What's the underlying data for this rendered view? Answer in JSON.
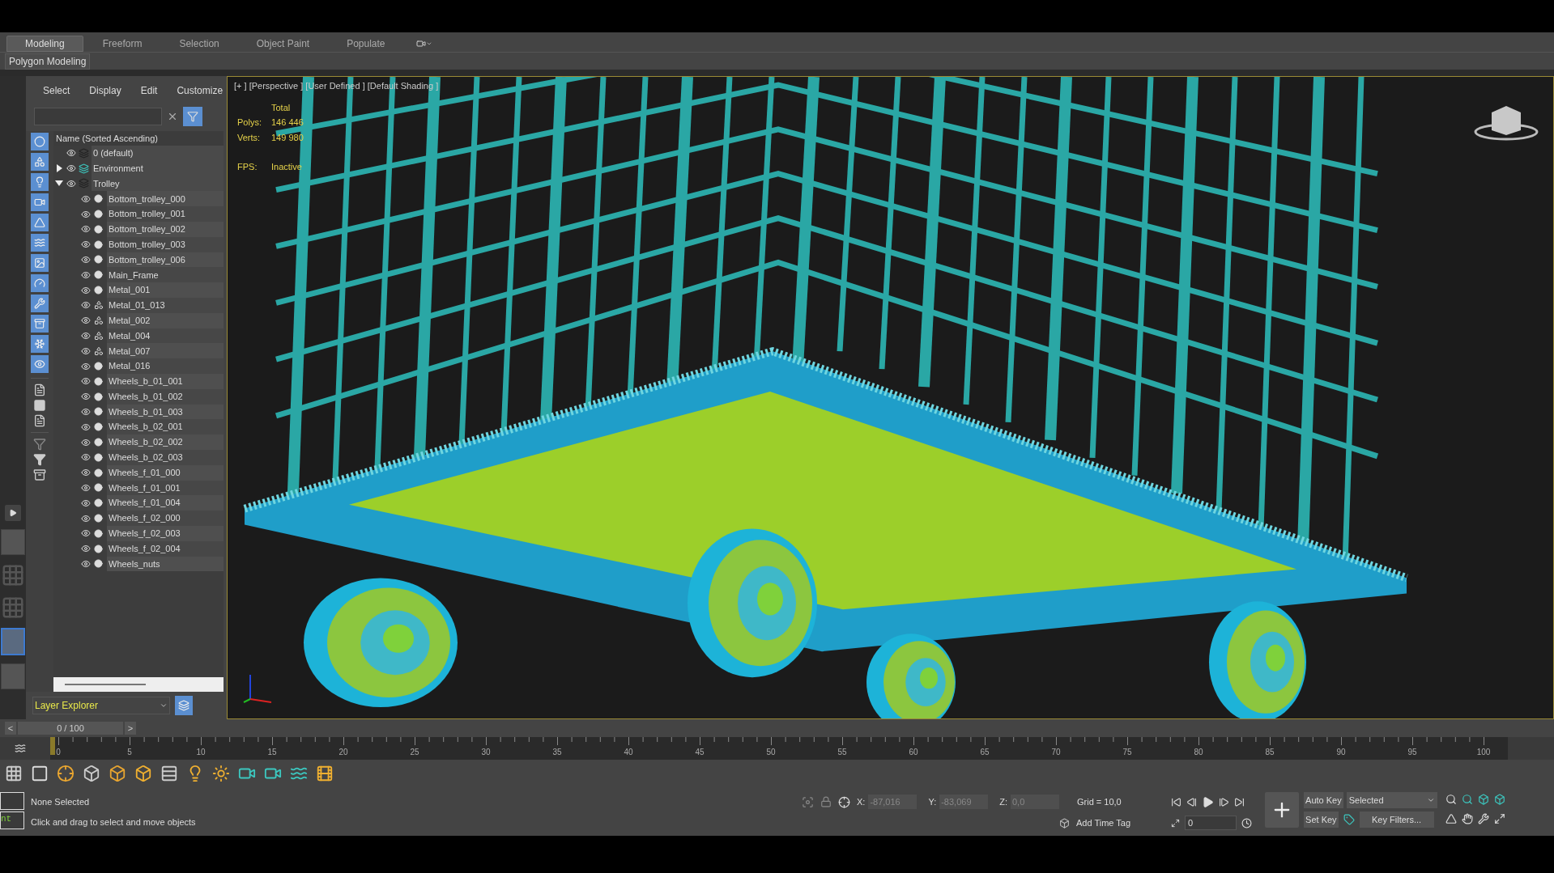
{
  "ribbon": {
    "tabs": [
      {
        "label": "Modeling",
        "selected": true
      },
      {
        "label": "Freeform",
        "selected": false
      },
      {
        "label": "Selection",
        "selected": false
      },
      {
        "label": "Object Paint",
        "selected": false
      },
      {
        "label": "Populate",
        "selected": false
      }
    ],
    "panel_label": "Polygon Modeling"
  },
  "scene_explorer": {
    "menu": [
      "Select",
      "Display",
      "Edit",
      "Customize"
    ],
    "column_header": "Name (Sorted Ascending)",
    "layers": [
      {
        "name": "0 (default)",
        "kind": "plain"
      },
      {
        "name": "Environment",
        "kind": "environment",
        "expanded": false
      },
      {
        "name": "Trolley",
        "kind": "plain",
        "expanded": true,
        "children": [
          {
            "name": "Bottom_trolley_000",
            "kind": "mesh"
          },
          {
            "name": "Bottom_trolley_001",
            "kind": "mesh"
          },
          {
            "name": "Bottom_trolley_002",
            "kind": "mesh"
          },
          {
            "name": "Bottom_trolley_003",
            "kind": "mesh"
          },
          {
            "name": "Bottom_trolley_006",
            "kind": "mesh"
          },
          {
            "name": "Main_Frame",
            "kind": "mesh"
          },
          {
            "name": "Metal_001",
            "kind": "mesh"
          },
          {
            "name": "Metal_01_013",
            "kind": "group"
          },
          {
            "name": "Metal_002",
            "kind": "group"
          },
          {
            "name": "Metal_004",
            "kind": "group"
          },
          {
            "name": "Metal_007",
            "kind": "group"
          },
          {
            "name": "Metal_016",
            "kind": "mesh"
          },
          {
            "name": "Wheels_b_01_001",
            "kind": "mesh"
          },
          {
            "name": "Wheels_b_01_002",
            "kind": "mesh"
          },
          {
            "name": "Wheels_b_01_003",
            "kind": "mesh"
          },
          {
            "name": "Wheels_b_02_001",
            "kind": "mesh"
          },
          {
            "name": "Wheels_b_02_002",
            "kind": "mesh"
          },
          {
            "name": "Wheels_b_02_003",
            "kind": "mesh"
          },
          {
            "name": "Wheels_f_01_000",
            "kind": "mesh"
          },
          {
            "name": "Wheels_f_01_001",
            "kind": "mesh"
          },
          {
            "name": "Wheels_f_01_004",
            "kind": "mesh"
          },
          {
            "name": "Wheels_f_02_000",
            "kind": "mesh"
          },
          {
            "name": "Wheels_f_02_003",
            "kind": "mesh"
          },
          {
            "name": "Wheels_f_02_004",
            "kind": "mesh"
          },
          {
            "name": "Wheels_nuts",
            "kind": "mesh"
          }
        ]
      }
    ],
    "explorer_dropdown": "Layer Explorer"
  },
  "viewport": {
    "label": "[+ ] [Perspective ] [User Defined ] [Default Shading ]",
    "total_label": "Total",
    "stats": [
      {
        "label": "Polys:",
        "value": "146 446"
      },
      {
        "label": "Verts:",
        "value": "149 980"
      }
    ],
    "fps": {
      "label": "FPS:",
      "value": "Inactive"
    }
  },
  "time_slider": {
    "prev": "<",
    "value": "0 / 100",
    "next": ">",
    "level": 0
  },
  "timeline": {
    "ticks": [
      "0",
      "5",
      "10",
      "15",
      "20",
      "25",
      "30",
      "35",
      "40",
      "45",
      "50",
      "55",
      "60",
      "65",
      "70",
      "75",
      "80",
      "85",
      "90",
      "95",
      "100"
    ]
  },
  "status_bar": {
    "listener_text": "nt",
    "selection": "None Selected",
    "prompt": "Click and drag to select and move objects",
    "coords": [
      {
        "label": "X:",
        "value": "-87,016",
        "disabled": true
      },
      {
        "label": "Y:",
        "value": "-83,069",
        "disabled": true
      },
      {
        "label": "Z:",
        "value": "0,0",
        "disabled": true
      }
    ],
    "grid": "Grid = 10,0",
    "time_tag": "Add Time Tag",
    "frame": "0",
    "auto_key": "Auto Key",
    "set_key": "Set Key",
    "key_mode": "Selected",
    "key_filters": "Key Filters..."
  }
}
